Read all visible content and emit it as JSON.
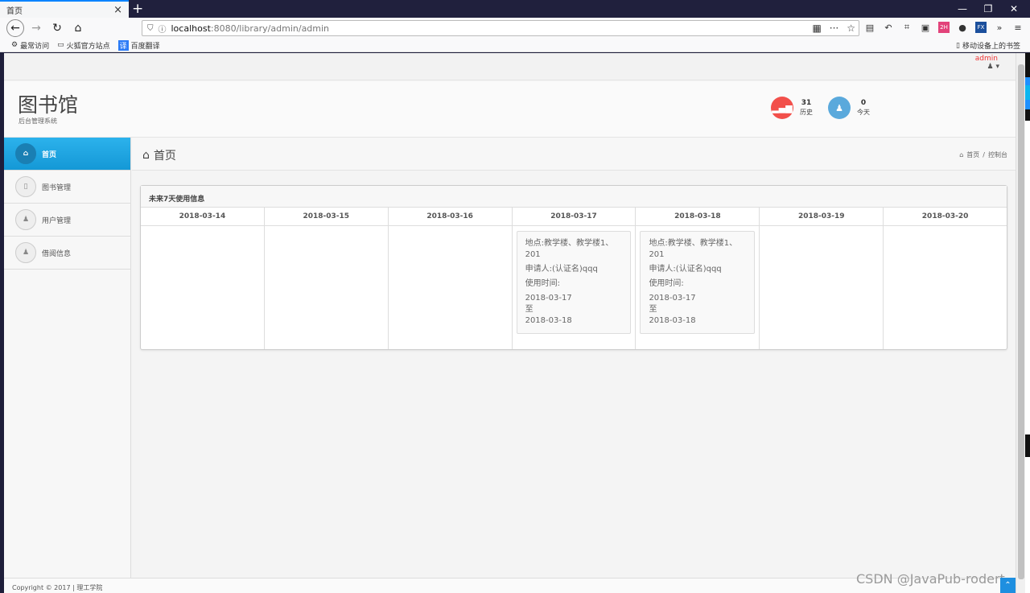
{
  "browser": {
    "tab_title": "首页",
    "tab_close": "×",
    "new_tab": "+",
    "minimize": "—",
    "restore": "❐",
    "close": "✕",
    "url_host": "localhost",
    "url_rest": ":8080/library/admin/admin",
    "bookmarks": [
      "最常访问",
      "火狐官方站点",
      "百度翻译"
    ],
    "bookmark_right": "移动设备上的书签",
    "ext_badge_2h": "2H",
    "ext_badge_fx": "FX"
  },
  "topbar": {
    "admin_name": "admin"
  },
  "header": {
    "title": "图书馆",
    "subtitle": "后台管理系统",
    "stats": [
      {
        "value": "31",
        "label": "历史",
        "color": "#f2504b"
      },
      {
        "value": "0",
        "label": "今天",
        "color": "#5aa9dc"
      }
    ]
  },
  "sidebar": {
    "items": [
      {
        "label": "首页",
        "icon": "home-icon",
        "active": true
      },
      {
        "label": "图书管理",
        "icon": "book-icon",
        "active": false
      },
      {
        "label": "用户管理",
        "icon": "user-icon",
        "active": false
      },
      {
        "label": "借阅信息",
        "icon": "user-icon",
        "active": false
      }
    ]
  },
  "content": {
    "page_title": "首页",
    "breadcrumb": [
      "首页",
      "控制台"
    ],
    "panel_title": "未来7天使用信息",
    "days": [
      {
        "date": "2018-03-14"
      },
      {
        "date": "2018-03-15"
      },
      {
        "date": "2018-03-16"
      },
      {
        "date": "2018-03-17",
        "card": {
          "place": "地点:教学楼、教学楼1、201",
          "applicant": "申请人:(认证名)qqq",
          "time_label": "使用时间:",
          "start": "2018-03-17",
          "to": "至",
          "end": "2018-03-18"
        }
      },
      {
        "date": "2018-03-18",
        "card": {
          "place": "地点:教学楼、教学楼1、201",
          "applicant": "申请人:(认证名)qqq",
          "time_label": "使用时间:",
          "start": "2018-03-17",
          "to": "至",
          "end": "2018-03-18"
        }
      },
      {
        "date": "2018-03-19"
      },
      {
        "date": "2018-03-20"
      }
    ]
  },
  "footer": {
    "text": "Copyright © 2017 | 理工学院"
  },
  "watermark": "CSDN @JavaPub-rodert"
}
